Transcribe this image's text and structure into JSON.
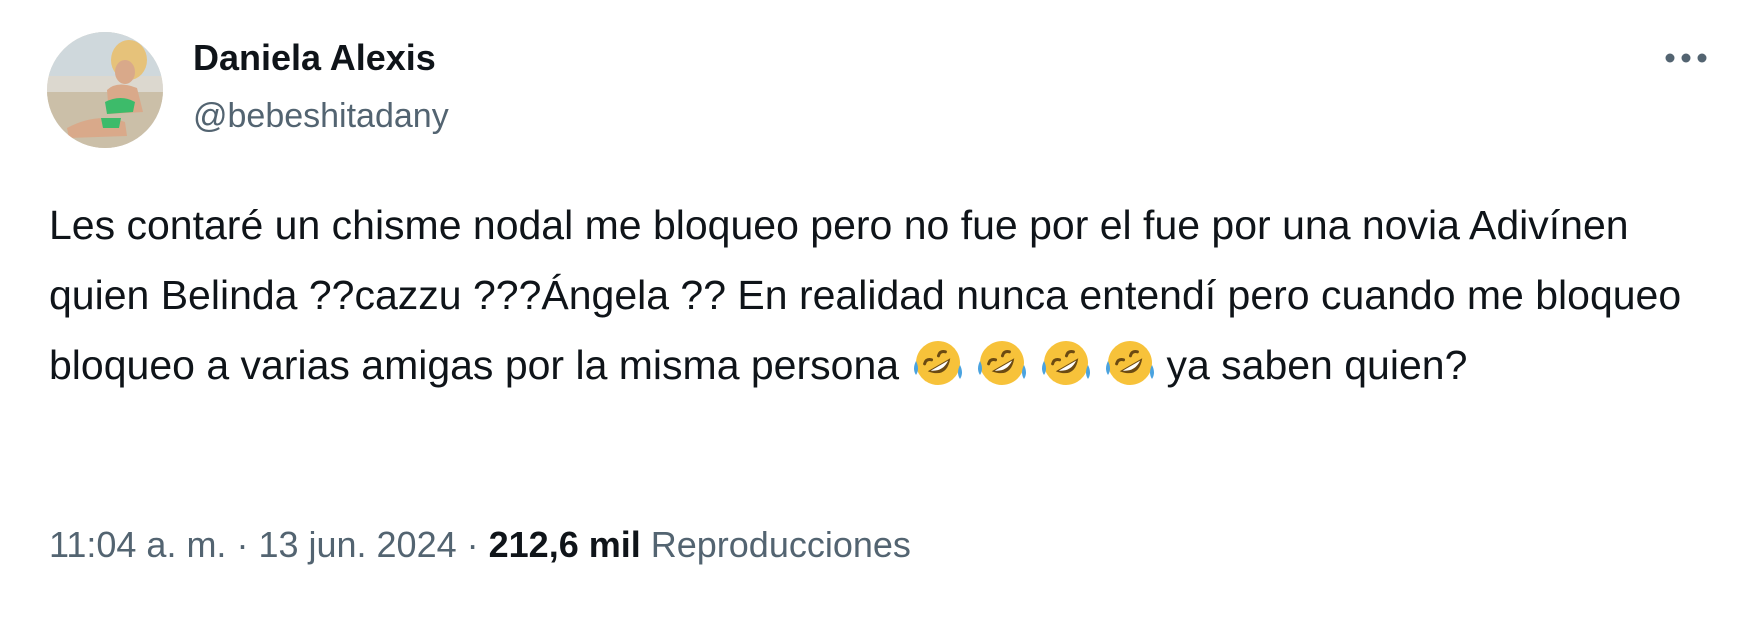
{
  "author": {
    "display_name": "Daniela Alexis",
    "handle": "@bebeshitadany",
    "avatar_icon": "profile-photo"
  },
  "more_icon": "more-dots-icon",
  "tweet": {
    "text": "Les contaré un chisme nodal me bloqueo pero no fue por el fue por una novia Adivínen quien Belinda ??cazzu ???Ángela ?? En realidad nunca entendí pero cuando me bloqueo bloqueo a varias amigas por la misma persona ",
    "emoji_name": "rolling-on-the-floor-laughing",
    "emoji_count": 4,
    "text_after_emoji": "ya saben quien?"
  },
  "meta": {
    "time": "11:04 a. m.",
    "separator": " · ",
    "date": "13 jun. 2024",
    "views_count": "212,6 mil",
    "views_label": "Reproducciones"
  },
  "colors": {
    "primary_text": "#0f1419",
    "secondary_text": "#536471",
    "background": "#ffffff",
    "emoji_face": "#f7c23a",
    "emoji_tear": "#4aa3e0"
  }
}
